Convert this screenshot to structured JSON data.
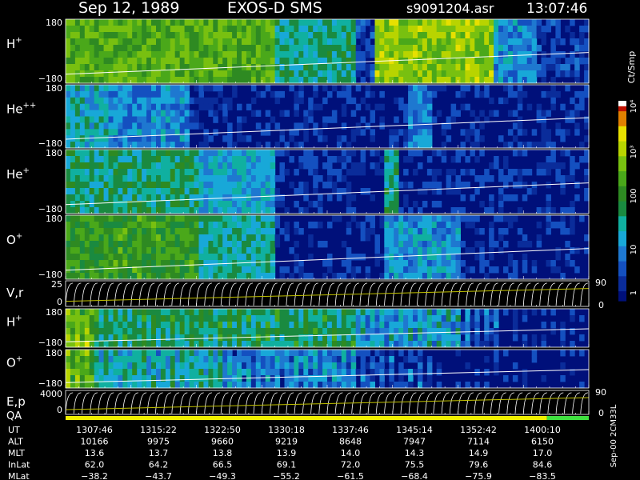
{
  "header": {
    "date": "Sep 12, 1989",
    "instrument": "EXOS-D SMS",
    "file": "s9091204.asr",
    "time": "13:07:46"
  },
  "colors": {
    "background": "#000000",
    "trace": "#ffffff",
    "qa_bar_yellow": "#f0f000",
    "qa_bar_green": "#40e040"
  },
  "chart_data": {
    "type": "heatmap",
    "panels": [
      {
        "label": "H",
        "sup": "+",
        "ytop": "180",
        "ybot": "−180"
      },
      {
        "label": "He",
        "sup": "++",
        "ytop": "180",
        "ybot": "−180"
      },
      {
        "label": "He",
        "sup": "+",
        "ytop": "180",
        "ybot": "−180"
      },
      {
        "label": "O",
        "sup": "+",
        "ytop": "180",
        "ybot": "−180"
      },
      {
        "label": "V,r",
        "sup": "",
        "ytop": "25",
        "ybot": "0",
        "rtop": "90",
        "rbot": "0"
      },
      {
        "label": "H",
        "sup": "+",
        "ytop": "180",
        "ybot": "−180"
      },
      {
        "label": "O",
        "sup": "+",
        "ytop": "180",
        "ybot": "−180"
      },
      {
        "label": "E,p",
        "sup": "",
        "ytop": "4000",
        "ybot": "0",
        "rtop": "90",
        "rbot": "0"
      }
    ],
    "qa_label": "QA",
    "colorbar": {
      "title": "Ct/Smp",
      "ticks": [
        "10⁴",
        "10³",
        "100",
        "10",
        "1"
      ]
    },
    "side_note": "Sep-00 2CM33L",
    "table": {
      "rows": [
        {
          "name": "UT",
          "values": [
            "1307:46",
            "1315:22",
            "1322:50",
            "1330:18",
            "1337:46",
            "1345:14",
            "1352:42",
            "1400:10"
          ]
        },
        {
          "name": "ALT",
          "values": [
            "10166",
            "9975",
            "9660",
            "9219",
            "8648",
            "7947",
            "7114",
            "6150"
          ]
        },
        {
          "name": "MLT",
          "values": [
            "13.6",
            "13.7",
            "13.8",
            "13.9",
            "14.0",
            "14.3",
            "14.9",
            "17.0"
          ]
        },
        {
          "name": "InLat",
          "values": [
            "62.0",
            "64.2",
            "66.5",
            "69.1",
            "72.0",
            "75.5",
            "79.6",
            "84.6"
          ]
        },
        {
          "name": "MLat",
          "values": [
            "−38.2",
            "−43.7",
            "−49.3",
            "−55.2",
            "−61.5",
            "−68.4",
            "−75.9",
            "−83.5"
          ]
        }
      ]
    }
  }
}
